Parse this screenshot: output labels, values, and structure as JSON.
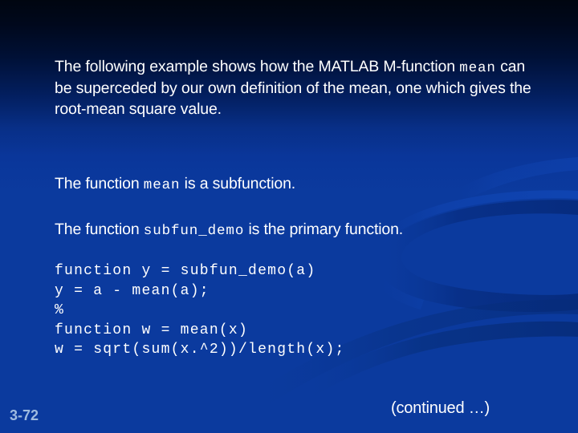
{
  "slide": {
    "background": {
      "gradient_top": "#000610",
      "gradient_bottom": "#0b3a9e",
      "accent_swoosh": "#0d44b4",
      "shadow_swoosh": "#083088"
    },
    "body": {
      "paragraph_1": {
        "segment_1": "The following example shows how the MATLAB M-function ",
        "code_1": "mean",
        "segment_2": " can be superceded by our own definition of the mean, one which gives the root-mean square value."
      },
      "paragraph_2": {
        "segment_1": "The function ",
        "code_1": "mean",
        "segment_2": " is a subfunction."
      },
      "paragraph_3": {
        "segment_1": "The function ",
        "code_1": "subfun_demo",
        "segment_2": " is the primary function."
      },
      "code_block": "function y = subfun_demo(a)\ny = a - mean(a);\n%\nfunction w = mean(x)\nw = sqrt(sum(x.^2))/length(x);"
    },
    "footer": {
      "page_number": "3-72",
      "continued_label": "(continued …)"
    }
  }
}
